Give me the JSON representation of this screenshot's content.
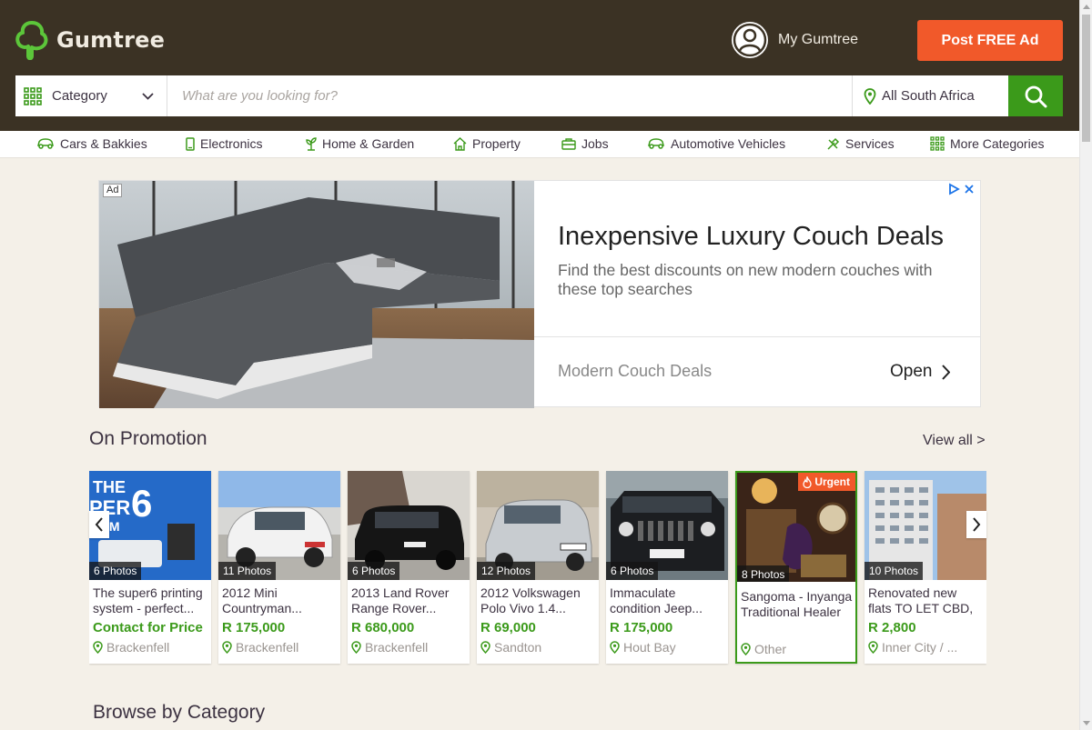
{
  "brand": {
    "name": "Gumtree",
    "accent": "#3b9a1a",
    "cta_color": "#f1592a",
    "header_bg": "#3b3224"
  },
  "header": {
    "my_gumtree": "My Gumtree",
    "post_ad": "Post FREE Ad"
  },
  "search": {
    "category": "Category",
    "placeholder": "What are you looking for?",
    "location": "All South Africa"
  },
  "categories": [
    {
      "label": "Cars & Bakkies",
      "icon": "car-icon"
    },
    {
      "label": "Electronics",
      "icon": "phone-icon"
    },
    {
      "label": "Home & Garden",
      "icon": "plant-icon"
    },
    {
      "label": "Property",
      "icon": "house-icon"
    },
    {
      "label": "Jobs",
      "icon": "briefcase-icon"
    },
    {
      "label": "Automotive Vehicles",
      "icon": "car-icon"
    },
    {
      "label": "Services",
      "icon": "tools-icon"
    },
    {
      "label": "More Categories",
      "icon": "grid-icon"
    }
  ],
  "ad": {
    "badge": "Ad",
    "headline": "Inexpensive Luxury Couch Deals",
    "body": "Find the best discounts on new modern couches with these top searches",
    "footer_text": "Modern Couch Deals",
    "open_label": "Open"
  },
  "promotion": {
    "title": "On Promotion",
    "view_all": "View all >",
    "listings": [
      {
        "photos": "6 Photos",
        "title": "The super6 printing system - perfect...",
        "price": "Contact for Price",
        "location": "Brackenfell",
        "urgent": false
      },
      {
        "photos": "11 Photos",
        "title": "2012 Mini Countryman...",
        "price": "R 175,000",
        "location": "Brackenfell",
        "urgent": false
      },
      {
        "photos": "6 Photos",
        "title": "2013 Land Rover Range Rover...",
        "price": "R 680,000",
        "location": "Brackenfell",
        "urgent": false
      },
      {
        "photos": "12 Photos",
        "title": "2012 Volkswagen Polo Vivo 1.4...",
        "price": "R 69,000",
        "location": "Sandton",
        "urgent": false
      },
      {
        "photos": "6 Photos",
        "title": "Immaculate condition Jeep...",
        "price": "R 175,000",
        "location": "Hout Bay",
        "urgent": false
      },
      {
        "photos": "8 Photos",
        "title": "Sangoma - Inyanga Traditional Healer",
        "price": "",
        "location": "Other",
        "urgent": true,
        "urgent_label": "Urgent"
      },
      {
        "photos": "10 Photos",
        "title": "Renovated new flats TO LET CBD, safe...",
        "price": "R 2,800",
        "location": "Inner City / ...",
        "urgent": false
      }
    ]
  },
  "browse": {
    "title": "Browse by Category"
  }
}
